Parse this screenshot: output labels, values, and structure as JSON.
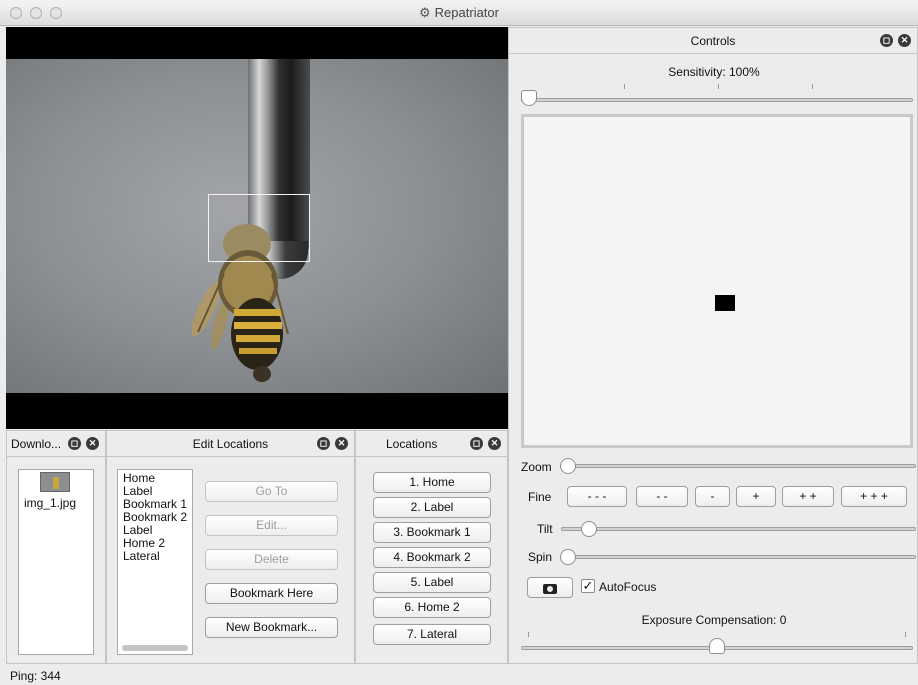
{
  "window": {
    "title": "Repatriator"
  },
  "downloads": {
    "title": "Downlo...",
    "items": [
      {
        "filename": "img_1.jpg",
        "icon": "image-thumbnail-icon"
      }
    ]
  },
  "edit_locations": {
    "title": "Edit Locations",
    "list": [
      "Home",
      "Label",
      "Bookmark 1",
      "Bookmark 2",
      "Label",
      "Home 2",
      "Lateral"
    ],
    "buttons": {
      "goto": "Go To",
      "edit": "Edit...",
      "delete": "Delete",
      "bookmark_here": "Bookmark Here",
      "new_bookmark": "New Bookmark..."
    }
  },
  "locations": {
    "title": "Locations",
    "buttons": [
      "1. Home",
      "2. Label",
      "3. Bookmark 1",
      "4. Bookmark 2",
      "5. Label",
      "6. Home 2",
      "7. Lateral"
    ]
  },
  "controls": {
    "title": "Controls",
    "sensitivity_label": "Sensitivity: 100%",
    "sensitivity_value": 1.0,
    "zoom_label": "Zoom",
    "fine_label": "Fine",
    "fine_buttons": [
      "- - -",
      "- -",
      "-",
      "+",
      "+ +",
      "+ + +"
    ],
    "tilt_label": "Tilt",
    "spin_label": "Spin",
    "autofocus_label": "AutoFocus",
    "autofocus_checked": true,
    "exposure_label": "Exposure Compensation: 0"
  },
  "status": {
    "ping": "Ping: 344"
  },
  "colors": {
    "accent_dark": "#3a3a3a",
    "panel_bg": "#ececec"
  }
}
